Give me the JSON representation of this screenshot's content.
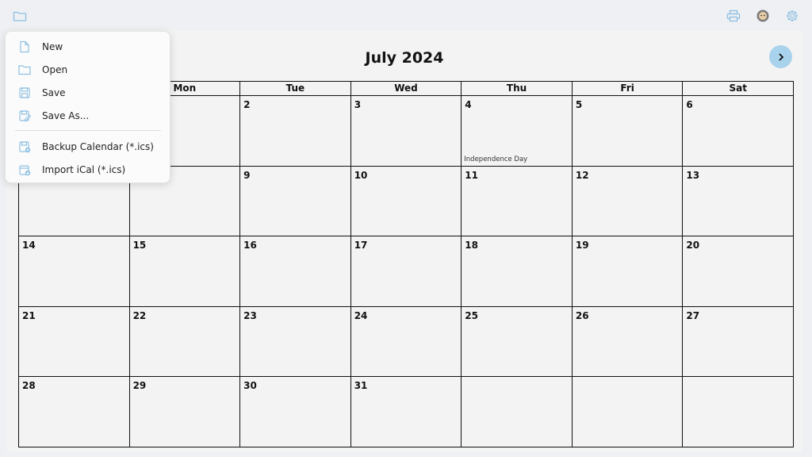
{
  "calendar": {
    "title": "July 2024",
    "weekdays": [
      "Mon",
      "Tue",
      "Wed",
      "Thu",
      "Fri",
      "Sat"
    ],
    "weeks": [
      [
        "",
        "2",
        "3",
        "4",
        "5",
        "6"
      ],
      [
        "",
        "9",
        "10",
        "11",
        "12",
        "13"
      ],
      [
        "14",
        "15",
        "16",
        "17",
        "18",
        "19",
        "20"
      ],
      [
        "21",
        "22",
        "23",
        "24",
        "25",
        "26",
        "27"
      ],
      [
        "28",
        "29",
        "30",
        "31",
        "",
        "",
        ""
      ]
    ],
    "events": {
      "4": "Independence Day"
    }
  },
  "menu": {
    "items": [
      {
        "label": "New",
        "icon": "new-file-icon"
      },
      {
        "label": "Open",
        "icon": "folder-open-icon"
      },
      {
        "label": "Save",
        "icon": "save-icon"
      },
      {
        "label": "Save As...",
        "icon": "save-as-icon"
      },
      {
        "label": "Backup Calendar (*.ics)",
        "icon": "backup-calendar-icon"
      },
      {
        "label": "Import iCal (*.ics)",
        "icon": "import-ical-icon"
      }
    ]
  },
  "toolbar": {
    "icons": [
      "folder-icon",
      "printer-icon",
      "avatar",
      "settings-gear-icon"
    ]
  },
  "colors": {
    "accent": "#a9d2ec",
    "icon": "#8ec0e2"
  }
}
